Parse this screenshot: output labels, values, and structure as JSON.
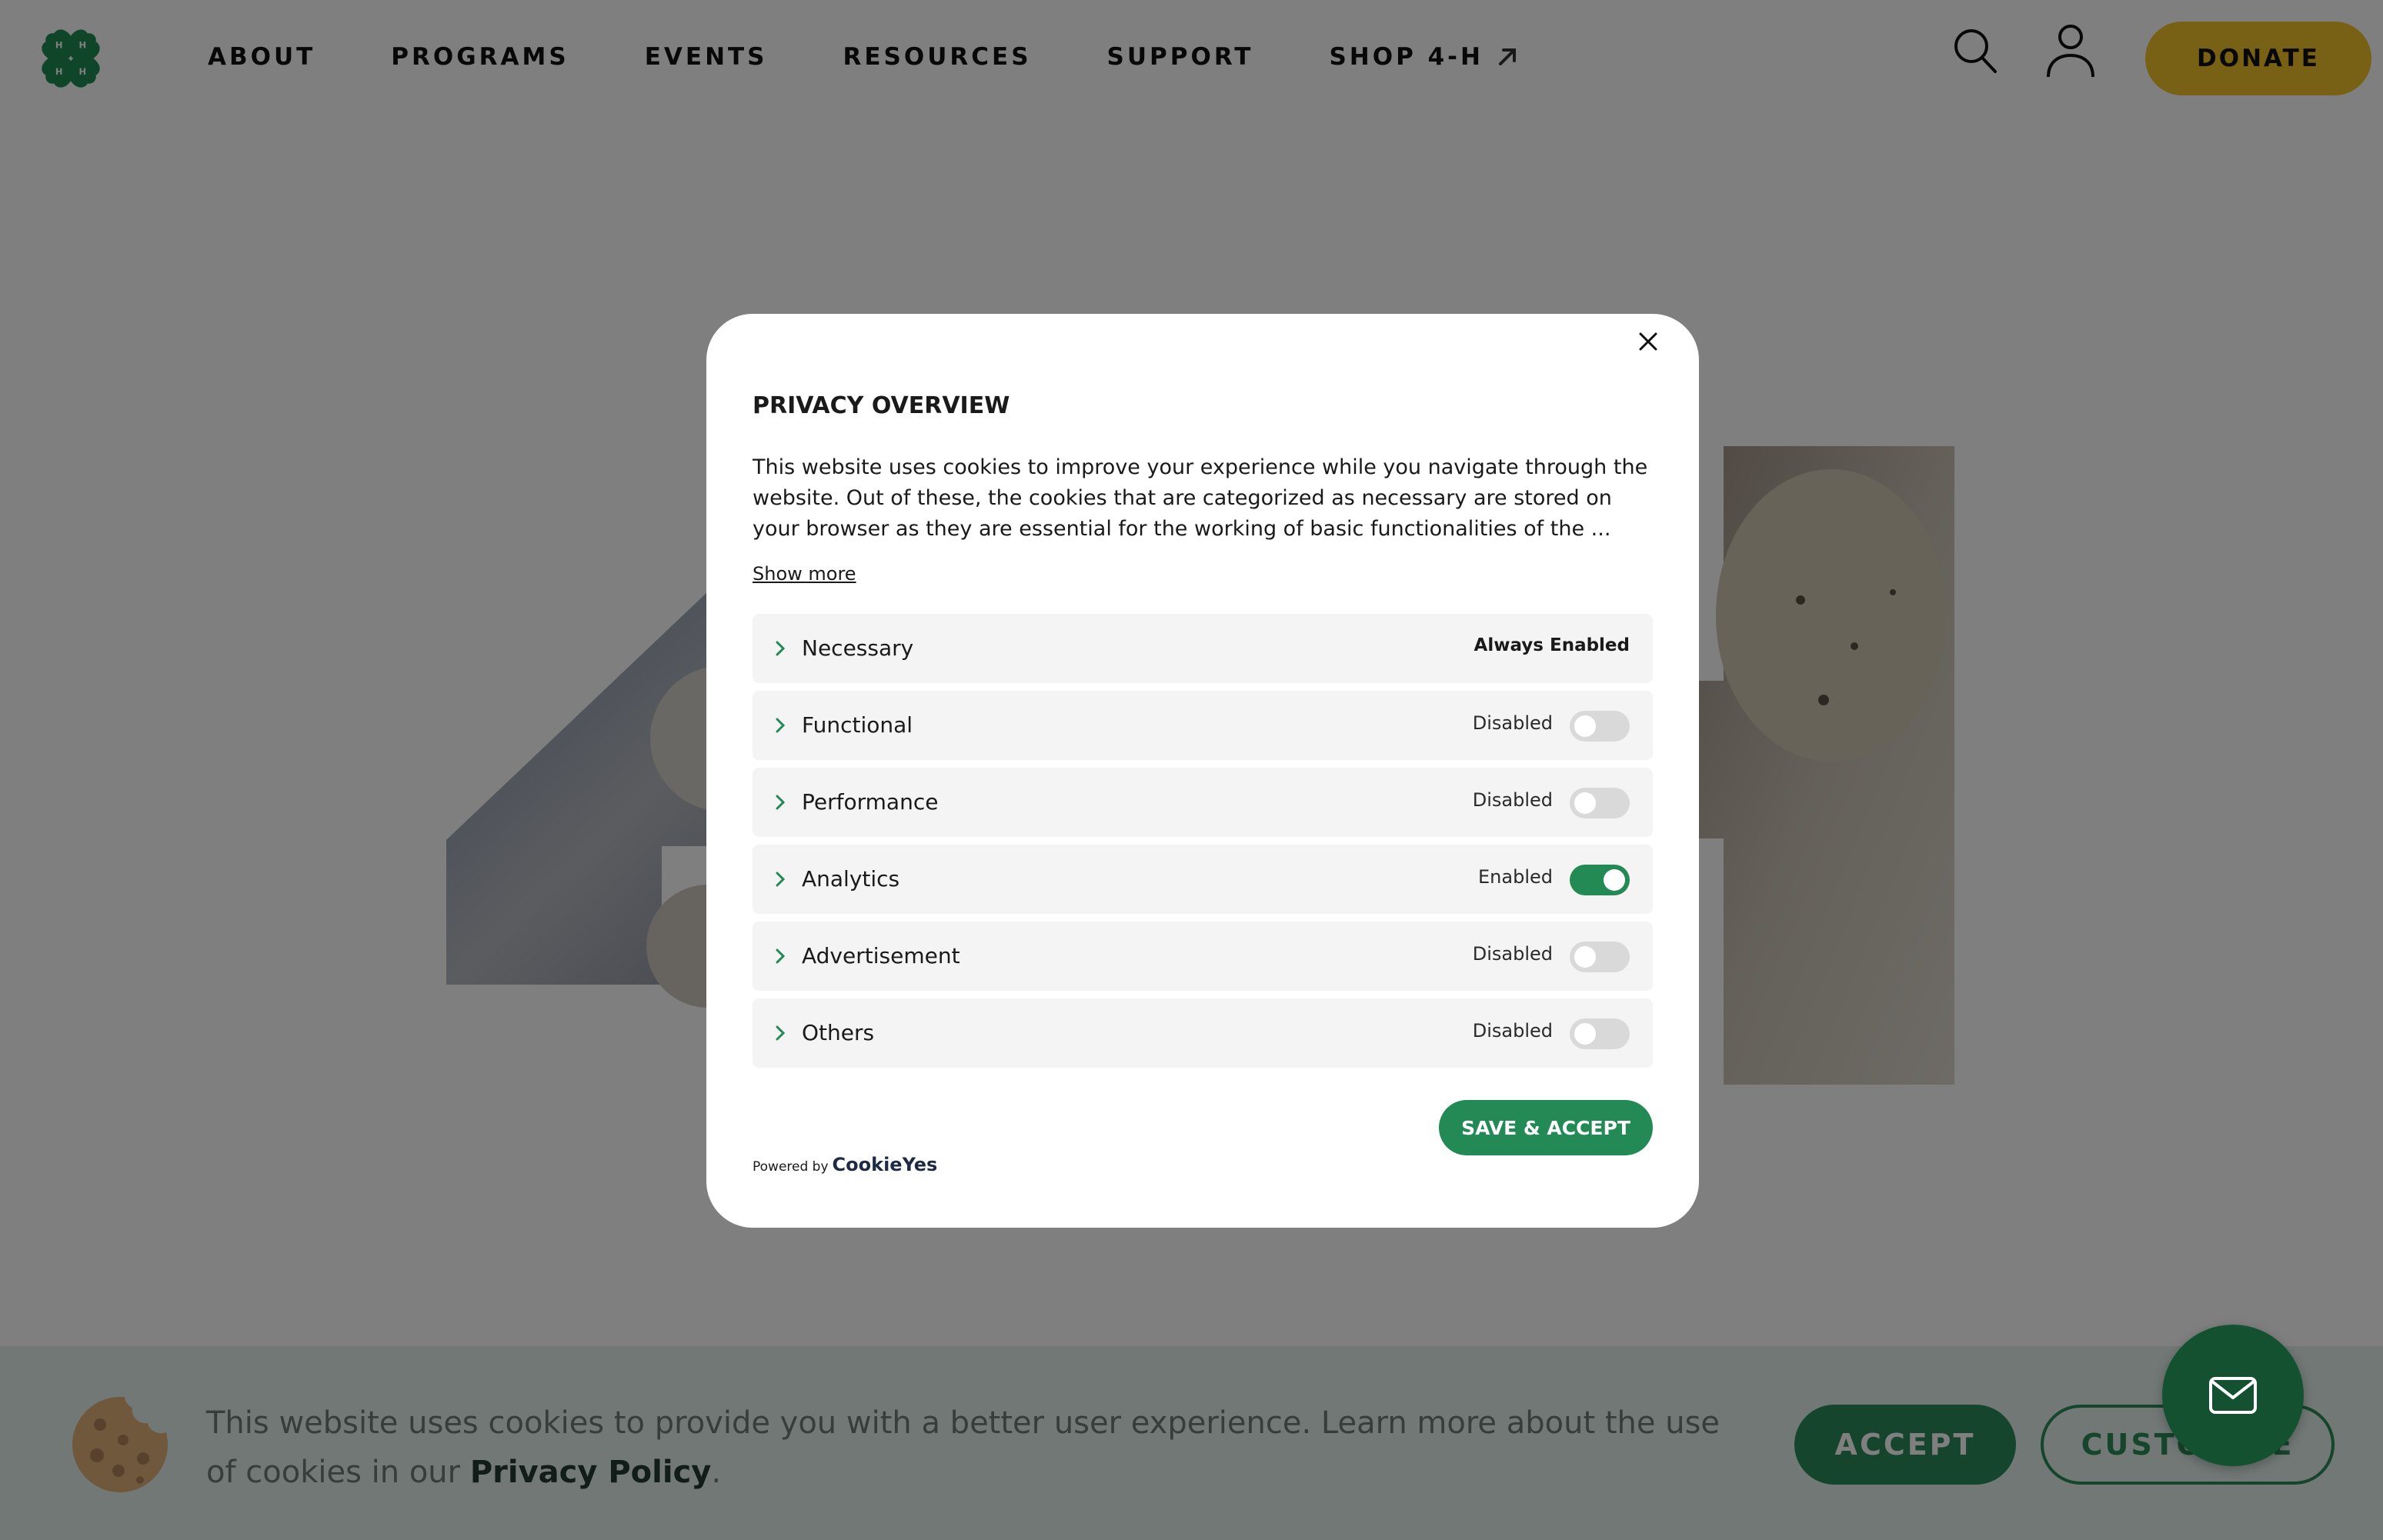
{
  "nav": {
    "logo_alt": "4-H clover logo",
    "links": [
      {
        "label": "ABOUT"
      },
      {
        "label": "PROGRAMS"
      },
      {
        "label": "EVENTS"
      },
      {
        "label": "RESOURCES"
      },
      {
        "label": "SUPPORT"
      },
      {
        "label": "SHOP 4-H",
        "external": true
      }
    ],
    "donate_label": "DONATE",
    "icons": {
      "search": "search-icon",
      "user": "user-icon",
      "external": "external-arrow-icon"
    }
  },
  "modal": {
    "title": "PRIVACY OVERVIEW",
    "description": "This website uses cookies to improve your experience while you navigate through the website. Out of these, the cookies that are categorized as necessary are stored on your browser as they are essential for the working of basic functionalities of the ...",
    "show_more": "Show more",
    "categories": [
      {
        "label": "Necessary",
        "status": "Always Enabled"
      },
      {
        "label": "Functional",
        "status": "Disabled",
        "enabled": false
      },
      {
        "label": "Performance",
        "status": "Disabled",
        "enabled": false
      },
      {
        "label": "Analytics",
        "status": "Enabled",
        "enabled": true
      },
      {
        "label": "Advertisement",
        "status": "Disabled",
        "enabled": false
      },
      {
        "label": "Others",
        "status": "Disabled",
        "enabled": false
      }
    ],
    "save_accept": "SAVE & ACCEPT",
    "powered_by": "Powered by",
    "powered_brand": "CookieYes"
  },
  "cookie_bar": {
    "text": "This website uses cookies to provide you with a better user experience. Learn more about the use of cookies in our ",
    "link": "Privacy Policy",
    "text_end": ".",
    "accept": "ACCEPT",
    "customize": "CUSTOMIZE"
  },
  "colors": {
    "brand_green": "#238a55",
    "donate_gold": "#f1c128",
    "chat_green": "#135131",
    "overlay": "rgba(0,0,0,0.5)"
  }
}
